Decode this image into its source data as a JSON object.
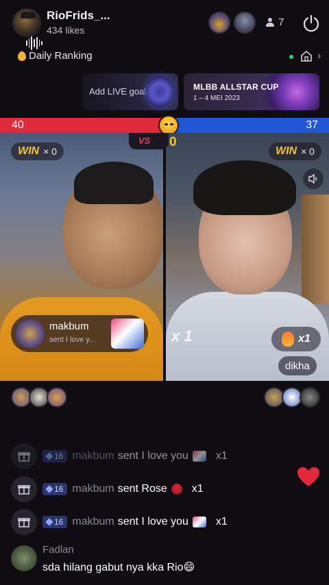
{
  "host": {
    "name": "RioFrids_...",
    "likes": "434 likes"
  },
  "viewers": {
    "count": "7"
  },
  "ranking": {
    "label": "Daily Ranking"
  },
  "banners": {
    "goal_label": "Add LIVE goal",
    "event_title": "MLBB ALLSTAR CUP",
    "event_date": "1 – 4 MEI 2023"
  },
  "battle": {
    "score_left": "40",
    "score_right": "37",
    "vs_label": "VS",
    "vs_points": "0",
    "win_word": "WIN",
    "win_left_count": "× 0",
    "win_right_count": "× 0",
    "colors": {
      "left": "#e0293b",
      "right": "#1f57d6"
    }
  },
  "left_video": {
    "gift_user": "makbum",
    "gift_text": "sent I love y..."
  },
  "right_video": {
    "multiplier": "x 1",
    "gift_count": "x1",
    "name_tag": "dikha"
  },
  "feed": [
    {
      "level": "16",
      "user": "makbum",
      "message": "sent I love you",
      "gift_icon": "love-you-gift-icon",
      "count": "x1"
    },
    {
      "level": "16",
      "user": "makbum",
      "message": "sent Rose",
      "gift_icon": "rose-icon",
      "count": "x1"
    },
    {
      "level": "16",
      "user": "makbum",
      "message": "sent I love you",
      "gift_icon": "love-you-gift-icon",
      "count": "x1"
    }
  ],
  "comment": {
    "user": "Fadlan",
    "text": "sda hilang gabut nya kka Rio😄"
  }
}
